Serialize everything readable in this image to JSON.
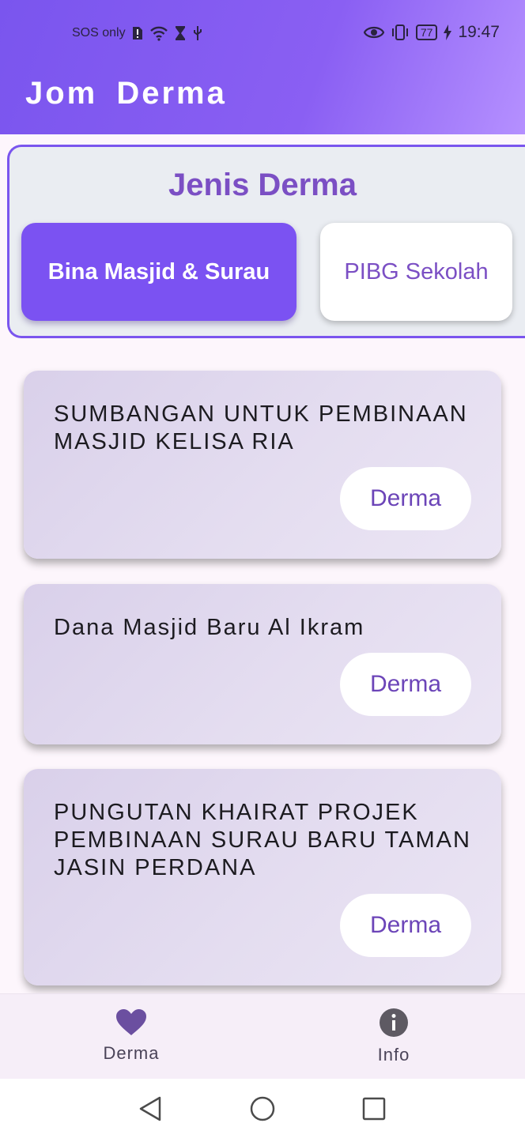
{
  "status_bar": {
    "carrier": "SOS only",
    "battery": "77",
    "time": "19:47"
  },
  "app": {
    "title": "Jom Derma"
  },
  "category_panel": {
    "title": "Jenis Derma",
    "tabs": [
      {
        "label": "Bina Masjid & Surau",
        "selected": true
      },
      {
        "label": "PIBG Sekolah",
        "selected": false
      }
    ]
  },
  "donations": [
    {
      "title": "SUMBANGAN UNTUK PEMBINAAN MASJID KELISA RIA",
      "button": "Derma"
    },
    {
      "title": "Dana Masjid Baru Al Ikram",
      "button": "Derma"
    },
    {
      "title": "PUNGUTAN KHAIRAT PROJEK PEMBINAAN SURAU BARU TAMAN JASIN PERDANA",
      "button": "Derma"
    }
  ],
  "bottom_nav": [
    {
      "label": "Derma",
      "icon": "heart-icon",
      "active": true
    },
    {
      "label": "Info",
      "icon": "info-icon",
      "active": false
    }
  ],
  "colors": {
    "primary": "#7b52f2",
    "accent_text": "#7b4fc4",
    "card_bg": "#e4ddf0"
  }
}
